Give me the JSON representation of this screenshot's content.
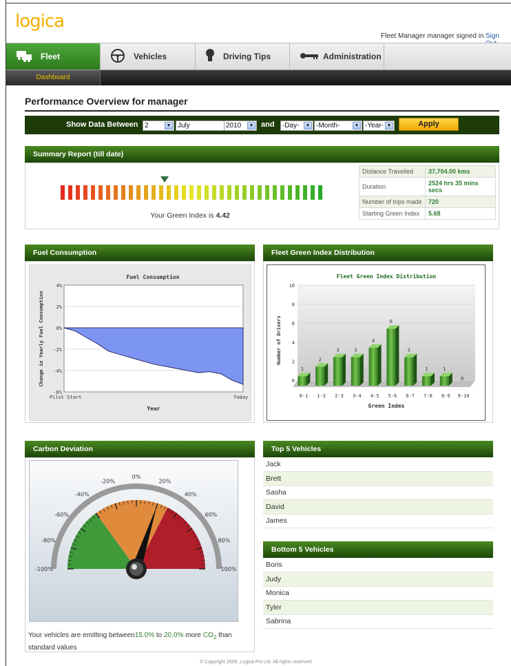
{
  "header": {
    "logo": "logica",
    "signed_in_text": "Fleet Manager manager signed in",
    "sign_out": "Sign Out"
  },
  "nav": {
    "tabs": [
      {
        "label": "Fleet",
        "icon": "fleet-icon",
        "active": true
      },
      {
        "label": "Vehicles",
        "icon": "steering-wheel-icon",
        "active": false
      },
      {
        "label": "Driving Tips",
        "icon": "bulb-icon",
        "active": false
      },
      {
        "label": "Administration",
        "icon": "key-icon",
        "active": false
      }
    ],
    "subnav": {
      "active": "Dashboard"
    }
  },
  "page": {
    "title": "Performance Overview for manager"
  },
  "filter": {
    "label": "Show Data Between",
    "from_day": "2",
    "from_month": "July",
    "from_year": "2010",
    "and_label": "and",
    "to_day": "-Day-",
    "to_month": "-Month-",
    "to_year": "-Year-",
    "apply": "Apply"
  },
  "summary": {
    "title": "Summary Report (till date)",
    "green_index_prefix": "Your Green Index is",
    "green_index_value": "4.42",
    "stats": [
      {
        "label": "Distance Travelled",
        "value": "37,704.00 kms"
      },
      {
        "label": "Duration",
        "value": "2524 hrs 35 mins secs"
      },
      {
        "label": "Number of trips made",
        "value": "720"
      },
      {
        "label": "Starting Green Index",
        "value": "5.68"
      }
    ]
  },
  "fuel": {
    "panel_title": "Fuel Consumption",
    "chart_data": {
      "type": "area",
      "title": "Fuel Consumption",
      "ylabel": "Change in Yearly Fuel Consumption",
      "xlabel": "Year",
      "x_ticks": [
        "Pilot Start",
        "Today"
      ],
      "y_ticks": [
        "4%",
        "2%",
        "0%",
        "-2%",
        "-4%",
        "-6%"
      ],
      "ylim": [
        -6,
        4
      ],
      "series": [
        {
          "values": [
            0,
            -0.3,
            -0.9,
            -1.5,
            -2.2,
            -2.5,
            -2.8,
            -3.1,
            -3.4,
            -3.6,
            -3.8,
            -4.0,
            -4.2,
            -4.1,
            -4.3,
            -4.9,
            -5.3
          ]
        }
      ]
    }
  },
  "distribution": {
    "panel_title": "Fleet Green Index Distribution",
    "chart_data": {
      "type": "bar",
      "title": "Fleet Green Index Distribution",
      "xlabel": "Green Index",
      "ylabel": "Number of Drivers",
      "categories": [
        "0-1",
        "1-2",
        "2-3",
        "3-4",
        "4-5",
        "5-6",
        "6-7",
        "7-8",
        "8-9",
        "9-10"
      ],
      "values": [
        1,
        2,
        3,
        3,
        4,
        6,
        3,
        1,
        1,
        0
      ],
      "y_ticks": [
        "0",
        "2",
        "4",
        "6",
        "8",
        "10"
      ],
      "ylim": [
        0,
        10
      ]
    }
  },
  "carbon": {
    "panel_title": "Carbon Deviation",
    "gauge_labels": [
      "-100%",
      "-80%",
      "-60%",
      "-40%",
      "-20%",
      "0%",
      "20%",
      "40%",
      "60%",
      "80%",
      "100%"
    ],
    "needle_value": 20,
    "text_prefix": "Your vehicles are emitting between",
    "low": "15.0%",
    "to": "to",
    "high": "20.0%",
    "more": "more",
    "co2": "CO",
    "co2_sub": "2",
    "suffix": "than standard values"
  },
  "top5": {
    "title": "Top 5 Vehicles",
    "items": [
      "Jack",
      "Brett",
      "Sasha",
      "David",
      "James"
    ]
  },
  "bottom5": {
    "title": "Bottom 5 Vehicles",
    "items": [
      "Boris",
      "Judy",
      "Monica",
      "Tyler",
      "Sabrina"
    ]
  },
  "footer": "© Copyright 2009, Logica Pvt Ltd. All rights reserved"
}
